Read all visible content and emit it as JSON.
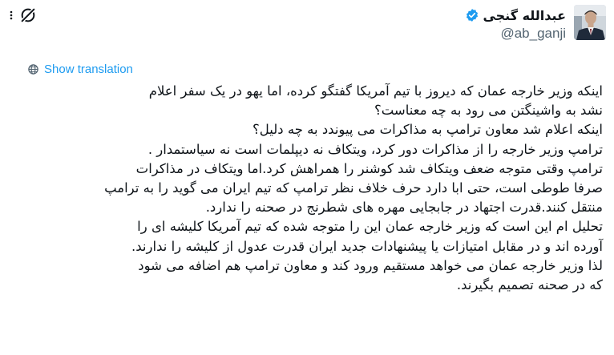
{
  "author": {
    "name": "عبدالله گنجی",
    "handle": "@ab_ganji",
    "verified": true,
    "verified_color": "#1d9bf0"
  },
  "icons": {
    "grok": "grok-icon",
    "more": "more-icon",
    "globe": "globe-icon",
    "verified": "verified-badge-icon"
  },
  "translation": {
    "label": "Show translation",
    "link_color": "#1d9bf0"
  },
  "tweet": {
    "lines": [
      "اینکه وزیر خارجه عمان که دیروز با تیم آمریکا گفتگو کرده، اما یهو در یک سفر اعلام",
      "نشد به واشینگتن می رود به چه معناست؟",
      "اینکه اعلام شد معاون ترامپ به مذاکرات می پیوندد به چه دلیل؟",
      "ترامپ وزیر خارجه را از مذاکرات دور کرد، ویتکاف نه دیپلمات است نه سیاستمدار .",
      "ترامپ وقتی متوجه ضعف ویتکاف  شد کوشنر را همراهش کرد.اما ویتکاف در مذاکرات",
      "صرفا طوطی است، حتی ابا دارد حرف خلاف نظر ترامپ که تیم ایران می گوید را به ترامپ",
      "منتقل کنند.قدرت اجتهاد در جابجایی مهره های شطرنج در صحنه را ندارد.",
      "تحلیل ام این است که وزیر خارجه عمان این را متوجه شده که تیم آمریکا کلیشه ای را",
      "آورده اند و در مقابل امتیازات یا پیشنهادات جدید ایران قدرت عدول از کلیشه را ندارند.",
      "لذا وزیر خارجه عمان می خواهد مستقیم ورود کند و معاون ترامپ هم اضافه می شود",
      "که در صحنه تصمیم بگیرند."
    ]
  }
}
